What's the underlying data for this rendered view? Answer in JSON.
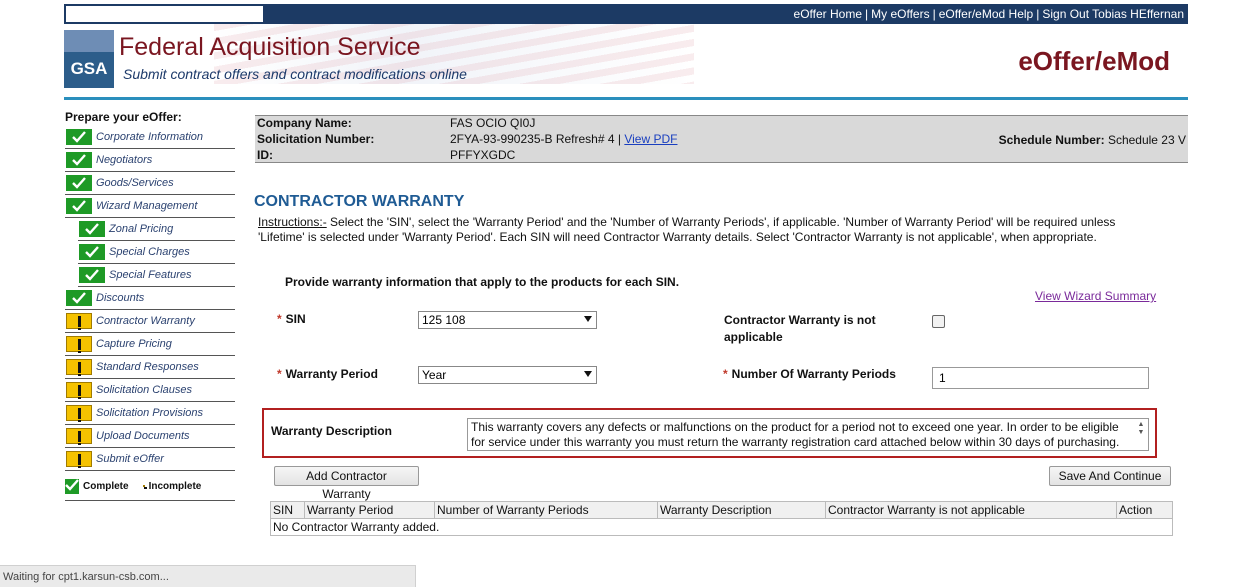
{
  "top_nav": {
    "links": [
      {
        "label": "eOffer Home",
        "name": "nav-eoffer-home"
      },
      {
        "label": "My eOffers",
        "name": "nav-my-eoffers"
      },
      {
        "label": "eOffer/eMod Help",
        "name": "nav-help"
      },
      {
        "label": "Sign Out Tobias HEffernan",
        "name": "nav-sign-out"
      }
    ],
    "separator": "|"
  },
  "header": {
    "logo_text": "GSA",
    "title": "Federal Acquisition Service",
    "tagline": "Submit contract offers and contract modifications online",
    "brand": "eOffer/eMod"
  },
  "sidebar": {
    "title": "Prepare your eOffer:",
    "items": [
      {
        "label": "Corporate Information",
        "status": "complete",
        "sub": false,
        "name": "sidebar-item-corporate-information"
      },
      {
        "label": "Negotiators",
        "status": "complete",
        "sub": false,
        "name": "sidebar-item-negotiators"
      },
      {
        "label": "Goods/Services",
        "status": "complete",
        "sub": false,
        "name": "sidebar-item-goods-services"
      },
      {
        "label": "Wizard Management",
        "status": "complete",
        "sub": false,
        "name": "sidebar-item-wizard-management"
      },
      {
        "label": "Zonal Pricing",
        "status": "complete",
        "sub": true,
        "name": "sidebar-item-zonal-pricing"
      },
      {
        "label": "Special Charges",
        "status": "complete",
        "sub": true,
        "name": "sidebar-item-special-charges"
      },
      {
        "label": "Special Features",
        "status": "complete",
        "sub": true,
        "name": "sidebar-item-special-features"
      },
      {
        "label": "Discounts",
        "status": "complete",
        "sub": false,
        "name": "sidebar-item-discounts"
      },
      {
        "label": "Contractor Warranty",
        "status": "incomplete",
        "sub": false,
        "name": "sidebar-item-contractor-warranty"
      },
      {
        "label": "Capture Pricing",
        "status": "incomplete",
        "sub": false,
        "name": "sidebar-item-capture-pricing"
      },
      {
        "label": "Standard Responses",
        "status": "incomplete",
        "sub": false,
        "name": "sidebar-item-standard-responses"
      },
      {
        "label": "Solicitation Clauses",
        "status": "incomplete",
        "sub": false,
        "name": "sidebar-item-solicitation-clauses"
      },
      {
        "label": "Solicitation Provisions",
        "status": "incomplete",
        "sub": false,
        "name": "sidebar-item-solicitation-provisions"
      },
      {
        "label": "Upload Documents",
        "status": "incomplete",
        "sub": false,
        "name": "sidebar-item-upload-documents"
      },
      {
        "label": "Submit eOffer",
        "status": "incomplete",
        "sub": false,
        "name": "sidebar-item-submit-eoffer"
      }
    ],
    "legend": {
      "complete": "Complete",
      "incomplete": "Incomplete"
    }
  },
  "company": {
    "name_label": "Company Name:",
    "name_value": "FAS OCIO QI0J",
    "solicitation_label": "Solicitation Number:",
    "solicitation_value": "2FYA-93-990235-B Refresh# 4 |",
    "view_pdf": "View PDF",
    "id_label": "ID:",
    "id_value": "PFFYXGDC",
    "schedule_label": "Schedule Number:",
    "schedule_value": "Schedule 23 V"
  },
  "main": {
    "section_title": "CONTRACTOR WARRANTY",
    "instructions_label": "Instructions:-",
    "instructions_text": " Select the 'SIN', select the 'Warranty Period' and the 'Number of Warranty Periods', if applicable. 'Number of Warranty Period' will be required unless 'Lifetime' is selected under 'Warranty Period'. Each SIN will need Contractor Warranty details. Select 'Contractor Warranty is not applicable', when appropriate.",
    "provide_text": "Provide warranty information that apply to the products for each SIN.",
    "view_wizard_summary": "View Wizard Summary",
    "required_marker": "*",
    "sin_label": "SIN",
    "sin_value": "125 108",
    "not_applicable_label": "Contractor Warranty is not applicable",
    "not_applicable_checked": false,
    "warranty_period_label": "Warranty Period",
    "warranty_period_value": "Year",
    "num_periods_label": "Number Of Warranty Periods",
    "num_periods_value": "1",
    "description_label": "Warranty Description",
    "description_value": "This warranty covers any defects or malfunctions on the product for a period not to exceed one year. In order to be eligible for service under this warranty you must return the warranty registration card attached below within 30 days of purchasing.",
    "add_button": "Add Contractor Warranty",
    "save_button": "Save And Continue"
  },
  "table": {
    "headers": [
      "SIN",
      "Warranty Period",
      "Number of Warranty Periods",
      "Warranty Description",
      "Contractor Warranty is not applicable",
      "Action"
    ],
    "empty_text": "No Contractor Warranty added."
  },
  "status_bar": "Waiting for cpt1.karsun-csb.com...",
  "colors": {
    "nav_bar": "#1c3a64",
    "header_title": "#7a1620",
    "header_rule": "#2a8fbd",
    "section_title": "#1f5b94",
    "complete_badge": "#1e9a26",
    "incomplete_badge": "#f5c200",
    "highlight_border": "#b22020"
  }
}
